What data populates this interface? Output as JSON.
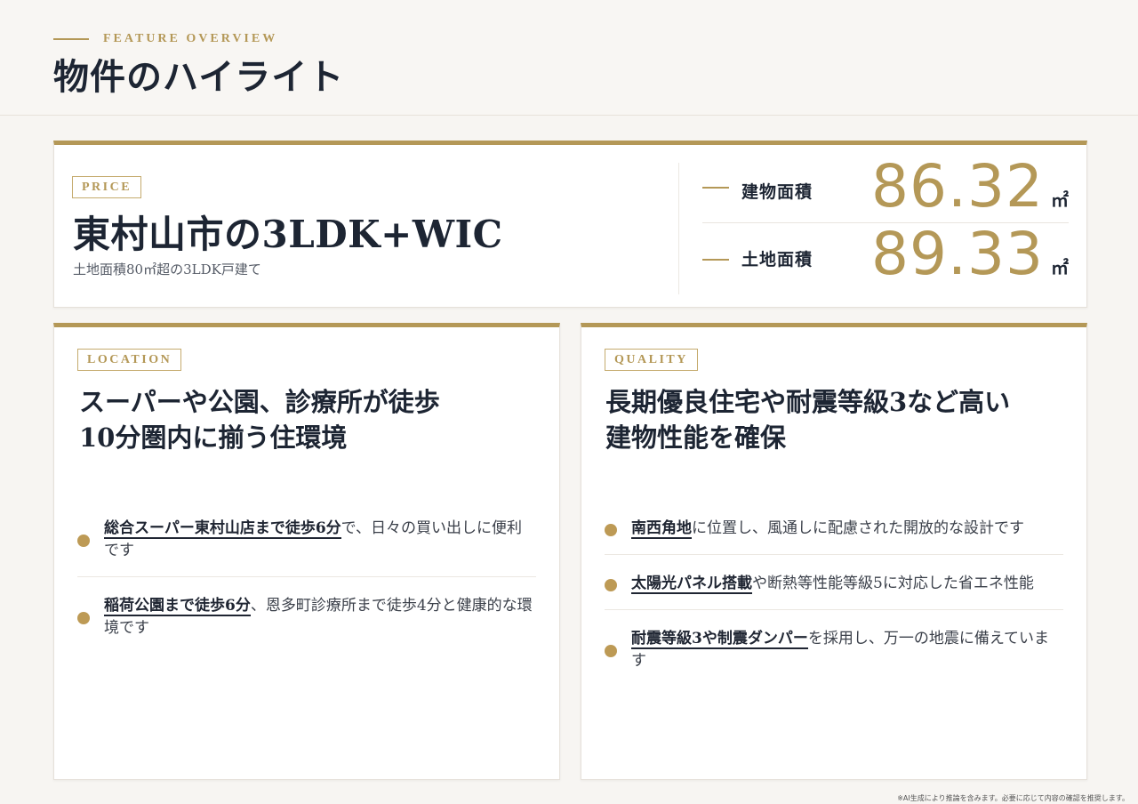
{
  "header": {
    "eyebrow": "FEATURE OVERVIEW",
    "title": "物件のハイライト"
  },
  "hero": {
    "tag": "PRICE",
    "title": "東村山市の3LDK+WIC",
    "subtitle": "土地面積80㎡超の3LDK戸建て",
    "metrics": [
      {
        "label": "建物面積",
        "value": "86.32",
        "unit": "㎡"
      },
      {
        "label": "土地面積",
        "value": "89.33",
        "unit": "㎡"
      }
    ]
  },
  "location": {
    "tag": "LOCATION",
    "title_line1": "スーパーや公園、診療所が徒歩",
    "title_line2": "10分圏内に揃う住環境",
    "points": [
      {
        "highlight": "総合スーパー東村山店まで徒歩6分",
        "rest": "で、日々の買い出しに便利です"
      },
      {
        "highlight": "稲荷公園まで徒歩6分",
        "rest": "、恩多町診療所まで徒歩4分と健康的な環境です"
      }
    ]
  },
  "quality": {
    "tag": "QUALITY",
    "title_line1": "長期優良住宅や耐震等級3など高い",
    "title_line2": "建物性能を確保",
    "points": [
      {
        "highlight": "南西角地",
        "rest": "に位置し、風通しに配慮された開放的な設計です"
      },
      {
        "highlight": "太陽光パネル搭載",
        "rest": "や断熱等性能等級5に対応した省エネ性能"
      },
      {
        "highlight": "耐震等級3や制震ダンパー",
        "rest": "を採用し、万一の地震に備えています"
      }
    ]
  },
  "footnote": "※AI生成により推論を含みます。必要に応じて内容の確認を推奨します。",
  "colors": {
    "accent": "#b49857",
    "text": "#1d2533",
    "background": "#f7f5f2"
  }
}
